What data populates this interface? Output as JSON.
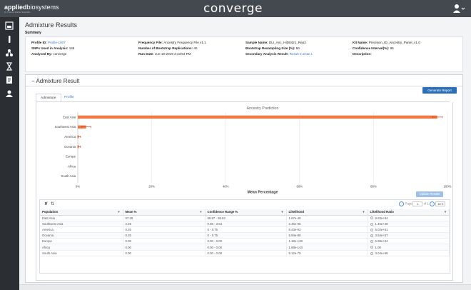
{
  "header": {
    "brand_bold": "applied",
    "brand_light": "biosystems",
    "brand_sub": "by Thermo Fisher Scientific",
    "app_title": "converge",
    "user_icon": "user-icon"
  },
  "sidebar": {
    "items": [
      {
        "icon": "instrument-icon"
      },
      {
        "icon": "test-tube-icon"
      },
      {
        "icon": "network-icon"
      },
      {
        "icon": "hourglass-icon"
      },
      {
        "icon": "report-icon"
      },
      {
        "icon": "users-icon"
      }
    ]
  },
  "page": {
    "title": "Admixture Results",
    "summary_label": "Summary"
  },
  "summary": {
    "profile_id_label": "Profile ID:",
    "profile_id_value": "Profile-1007",
    "snps_label": "SNPs Used in Analysis:",
    "snps_value": "145",
    "analysed_by_label": "Analysed By:",
    "analysed_by_value": "converge",
    "freq_file_label": "Frequency File:",
    "freq_file_value": "Ancestry Frequency File v1.1",
    "bootstrap_reps_label": "Number of Bootstrap Replications:",
    "bootstrap_reps_value": "40",
    "run_date_label": "Run Date:",
    "run_date_value": "Jun-19-2019 4:43:54 PM",
    "sample_name_label": "Sample Name:",
    "sample_name_value": "DLI_Anc_HID0421_Rep2",
    "resampling_label": "Bootstrap Resampling Size (%):",
    "resampling_value": "50",
    "secondary_label": "Secondary Analysis Result:",
    "secondary_value": "Result 0.1042.1",
    "kit_label": "Kit Name:",
    "kit_value": "Precision_ID_Ancestry_Panel_v1.0",
    "confidence_label": "Confidence Interval(%):",
    "confidence_value": "95",
    "description_label": "Description:",
    "description_value": ""
  },
  "result": {
    "heading": "Admixture Result",
    "generate_button": "Generate Report",
    "tabs": [
      {
        "label": "Admixture",
        "active": true
      },
      {
        "label": "Profile",
        "active": false
      }
    ],
    "update_button": "Update Results"
  },
  "chart_data": {
    "type": "bar",
    "orientation": "horizontal",
    "title": "Ancestry Prediction",
    "xlabel": "Mean Percentage",
    "ylabel": "",
    "xlim": [
      0,
      100
    ],
    "xticks": [
      "0%",
      "20%",
      "40%",
      "60%",
      "80%",
      "100%"
    ],
    "categories": [
      "East Asia",
      "Southwest Asia",
      "America",
      "Oceania",
      "Europe",
      "Africa",
      "South Asia"
    ],
    "values": [
      97.25,
      2.25,
      0.25,
      0.25,
      0.0,
      0.0,
      0.0
    ],
    "error_low": [
      95.87,
      0.96,
      0.0,
      0.0,
      0.0,
      0.0,
      0.0
    ],
    "error_high": [
      98.63,
      3.54,
      0.75,
      0.75,
      0.0,
      0.0,
      0.0
    ],
    "bar_color": "#f07a45",
    "grid": true
  },
  "table": {
    "page_label": "Page",
    "page_value": "1",
    "of_label": "of 1",
    "page_size": "10",
    "columns": [
      "Population",
      "Mean %",
      "Confidence Range %",
      "Likelihood",
      "Likelihood Ratio"
    ],
    "rows": [
      [
        "East Asia",
        "97.25",
        "95.87 - 98.63",
        "1.67e-48",
        "9.93e+94"
      ],
      [
        "Southwest Asia",
        "2.25",
        "0.96 - 3.54",
        "2.46e-95",
        "1.46e+48"
      ],
      [
        "America",
        "0.25",
        "0 - 0.75",
        "8.43e-92",
        "5.02e+51"
      ],
      [
        "Oceania",
        "0.25",
        "0 - 0.75",
        "5.94e-86",
        "3.54e+57"
      ],
      [
        "Europe",
        "0.00",
        "0.00 - 0.00",
        "1.18e-138",
        "6.98e+04"
      ],
      [
        "Africa",
        "0.00",
        "0.00 - 0.00",
        "1.68e-143",
        "1.00"
      ],
      [
        "South Asia",
        "0.00",
        "0.00 - 0.00",
        "5.12e-75",
        "3.04e+68"
      ]
    ]
  },
  "colors": {
    "topbar": "#44484f",
    "sidebar": "#2b2e33",
    "accent": "#2d6fb7",
    "bar": "#f07a45"
  }
}
